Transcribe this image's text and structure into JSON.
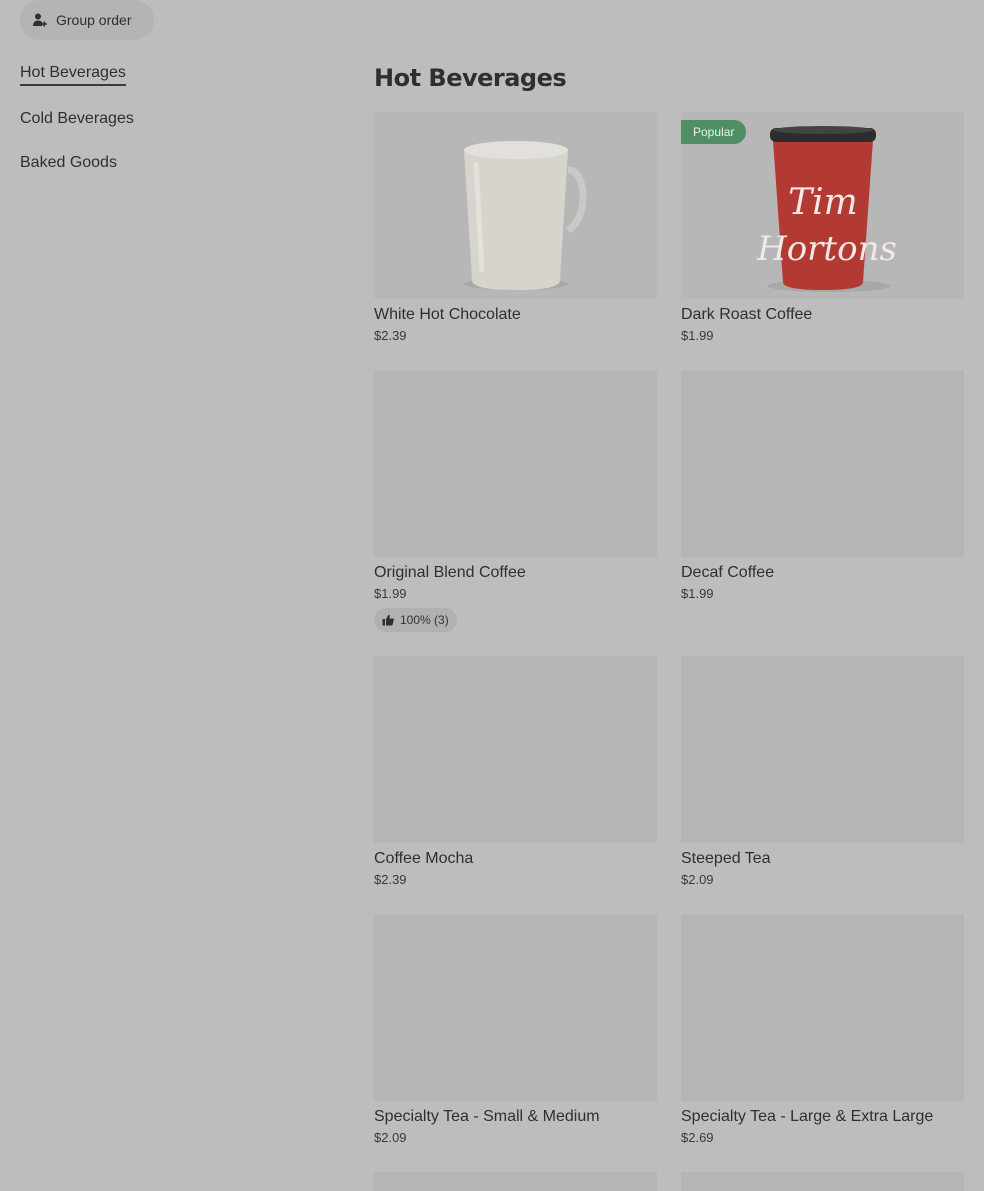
{
  "header": {
    "group_order_label": "Group order"
  },
  "sidebar": {
    "items": [
      {
        "label": "Hot Beverages"
      },
      {
        "label": "Cold Beverages"
      },
      {
        "label": "Baked Goods"
      }
    ]
  },
  "section": {
    "title": "Hot Beverages",
    "items": [
      {
        "name": "White Hot Chocolate",
        "price": "$2.39"
      },
      {
        "name": "Dark Roast Coffee",
        "price": "$1.99",
        "badge": "Popular"
      },
      {
        "name": "Original Blend Coffee",
        "price": "$1.99",
        "rating": "100% (3)"
      },
      {
        "name": "Decaf Coffee",
        "price": "$1.99"
      },
      {
        "name": "Coffee Mocha",
        "price": "$2.39"
      },
      {
        "name": "Steeped Tea",
        "price": "$2.09"
      },
      {
        "name": "Specialty Tea - Small & Medium",
        "price": "$2.09"
      },
      {
        "name": "Specialty Tea - Large & Extra Large",
        "price": "$2.69"
      }
    ]
  },
  "cup_logo_text": [
    "Tim",
    "Hortons"
  ],
  "icons": {
    "group_order": "person-add-icon",
    "rating": "thumbs-up-icon"
  },
  "colors": {
    "badge": "#4f8f63",
    "background": "#bdbdbd",
    "image_placeholder": "#b5b5b5"
  }
}
